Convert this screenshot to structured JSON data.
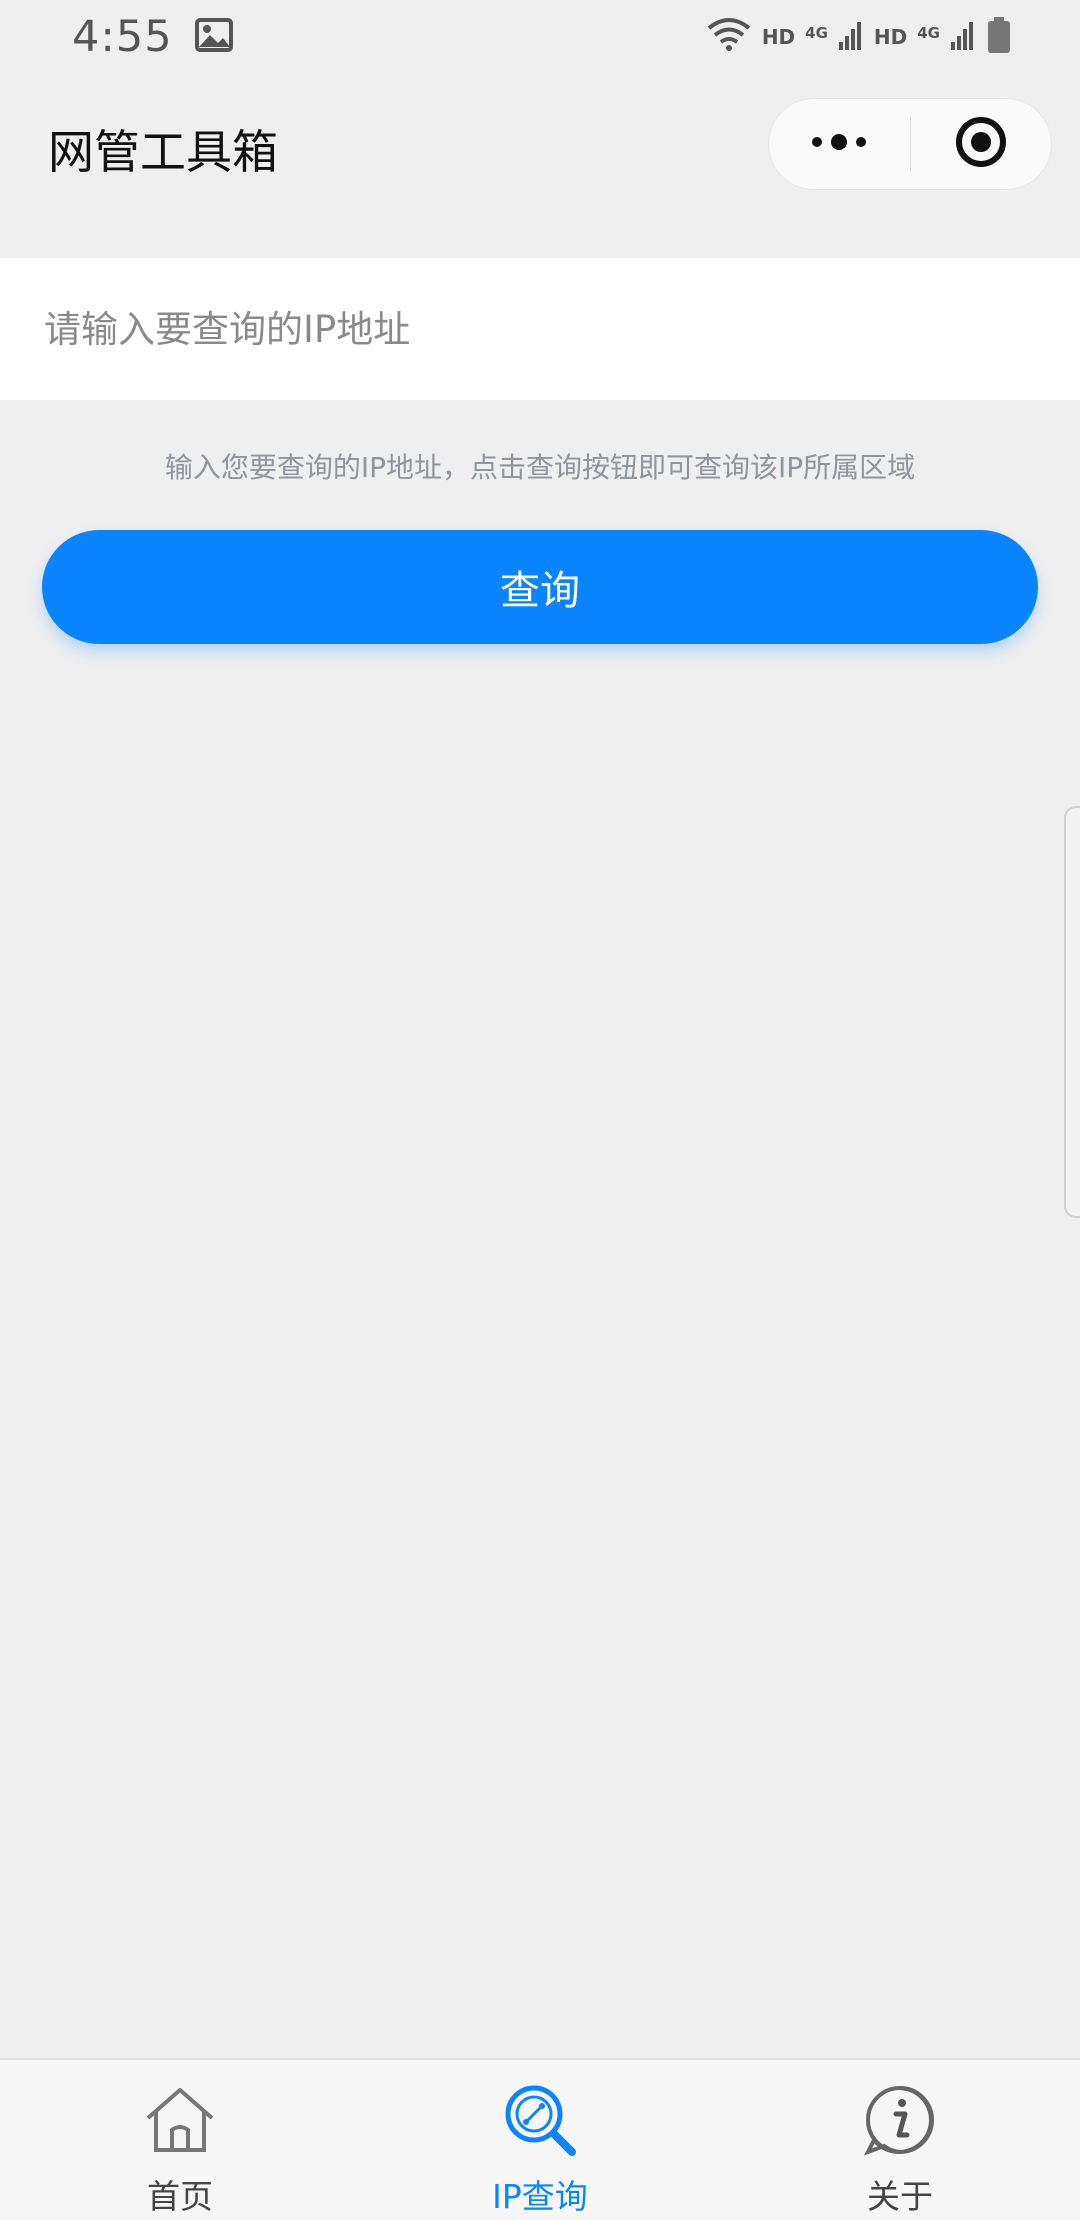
{
  "status_bar": {
    "time": "4:55",
    "network_1": "HD",
    "network_1_gen": "4G",
    "network_2": "HD",
    "network_2_gen": "4G",
    "icons": [
      "image-icon",
      "wifi-icon",
      "signal-icon",
      "battery-icon"
    ]
  },
  "nav": {
    "title": "网管工具箱",
    "icons": [
      "more-icon",
      "target-icon"
    ]
  },
  "search": {
    "placeholder": "请输入要查询的IP地址",
    "value": ""
  },
  "hint": "输入您要查询的IP地址，点击查询按钮即可查询该IP所属区域",
  "query_button": "查询",
  "tabs": [
    {
      "label": "首页",
      "icon": "home-icon",
      "active": false
    },
    {
      "label": "IP查询",
      "icon": "ip-search-icon",
      "active": true
    },
    {
      "label": "关于",
      "icon": "info-icon",
      "active": false
    }
  ],
  "colors": {
    "accent": "#0a84ff",
    "background": "#efeff0",
    "inactive_icon": "#666666"
  }
}
